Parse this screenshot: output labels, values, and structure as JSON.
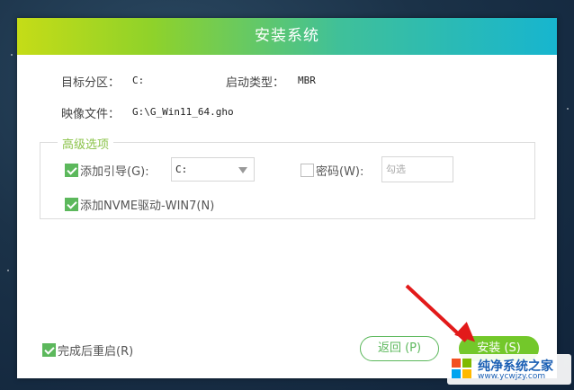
{
  "dialog": {
    "title": "安装系统"
  },
  "info": {
    "target_label": "目标分区：",
    "target_value": "C:",
    "boot_label": "启动类型：",
    "boot_value": "MBR",
    "image_label": "映像文件：",
    "image_value": "G:\\G_Win11_64.gho"
  },
  "advanced": {
    "title": "高级选项",
    "add_boot": {
      "label": "添加引导(G):",
      "checked": true
    },
    "boot_drive": {
      "selected": "C:"
    },
    "password": {
      "label": "密码(W):",
      "checked": false,
      "placeholder": "勾选"
    },
    "add_nvme": {
      "label": "添加NVME驱动-WIN7(N)",
      "checked": true
    }
  },
  "footer": {
    "restart": {
      "label": "完成后重启(R)",
      "checked": true
    },
    "back_label": "返回 (P)",
    "install_label": "安装 (S)"
  },
  "watermark": {
    "title": "纯净系统之家",
    "url": "www.ycwjzy.com"
  },
  "colors": {
    "accent_green": "#73c82a",
    "check_green": "#5cb85c",
    "arrow_red": "#e21a1a"
  }
}
